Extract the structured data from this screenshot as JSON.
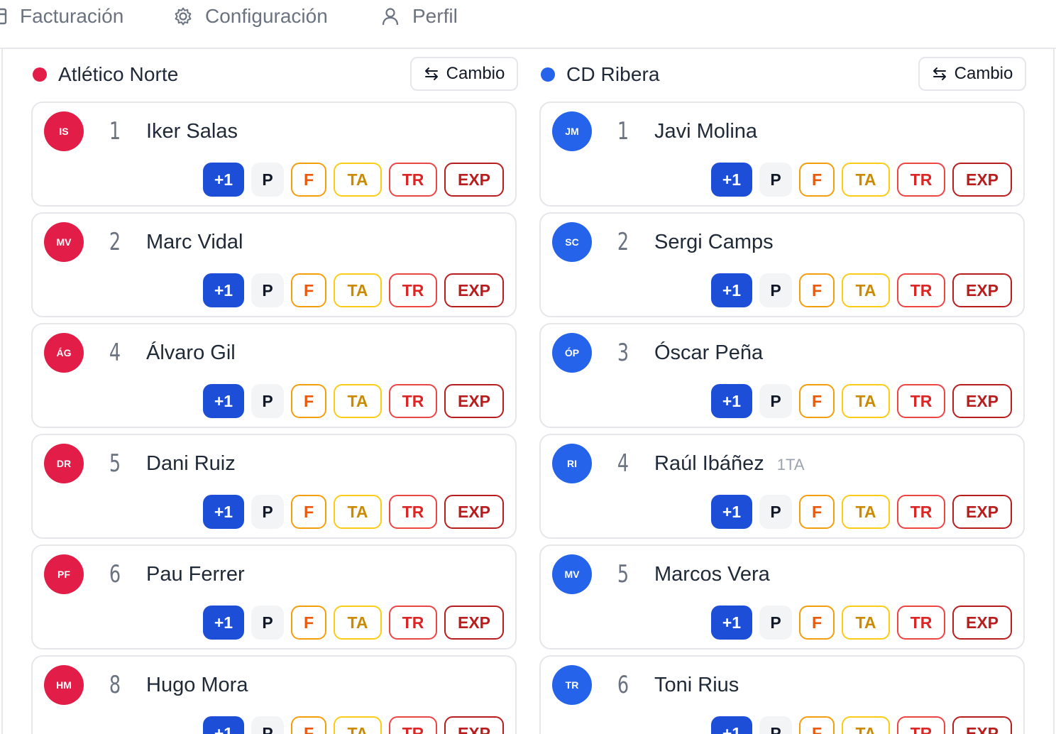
{
  "nav": {
    "items": [
      {
        "label": "Facturación",
        "icon": "billing-icon"
      },
      {
        "label": "Configuración",
        "icon": "gear-icon"
      },
      {
        "label": "Perfil",
        "icon": "user-icon"
      }
    ]
  },
  "colors": {
    "home": "#e11d48",
    "away": "#2563eb",
    "primary": "#1d4ed8"
  },
  "actions": {
    "goal": "+1",
    "p": "P",
    "f": "F",
    "ta": "TA",
    "tr": "TR",
    "exp": "EXP"
  },
  "teams": [
    {
      "name": "Atlético Norte",
      "sub_label": "Cambio",
      "color": "#e11d48",
      "players": [
        {
          "initials": "IS",
          "number": "1",
          "name": "Iker Salas",
          "note": ""
        },
        {
          "initials": "MV",
          "number": "2",
          "name": "Marc Vidal",
          "note": ""
        },
        {
          "initials": "ÁG",
          "number": "4",
          "name": "Álvaro Gil",
          "note": ""
        },
        {
          "initials": "DR",
          "number": "5",
          "name": "Dani Ruiz",
          "note": ""
        },
        {
          "initials": "PF",
          "number": "6",
          "name": "Pau Ferrer",
          "note": ""
        },
        {
          "initials": "HM",
          "number": "8",
          "name": "Hugo Mora",
          "note": ""
        }
      ]
    },
    {
      "name": "CD Ribera",
      "sub_label": "Cambio",
      "color": "#2563eb",
      "players": [
        {
          "initials": "JM",
          "number": "1",
          "name": "Javi Molina",
          "note": ""
        },
        {
          "initials": "SC",
          "number": "2",
          "name": "Sergi Camps",
          "note": ""
        },
        {
          "initials": "ÓP",
          "number": "3",
          "name": "Óscar Peña",
          "note": ""
        },
        {
          "initials": "RI",
          "number": "4",
          "name": "Raúl Ibáñez",
          "note": "1TA"
        },
        {
          "initials": "MV",
          "number": "5",
          "name": "Marcos Vera",
          "note": ""
        },
        {
          "initials": "TR",
          "number": "6",
          "name": "Toni Rius",
          "note": ""
        }
      ]
    }
  ]
}
